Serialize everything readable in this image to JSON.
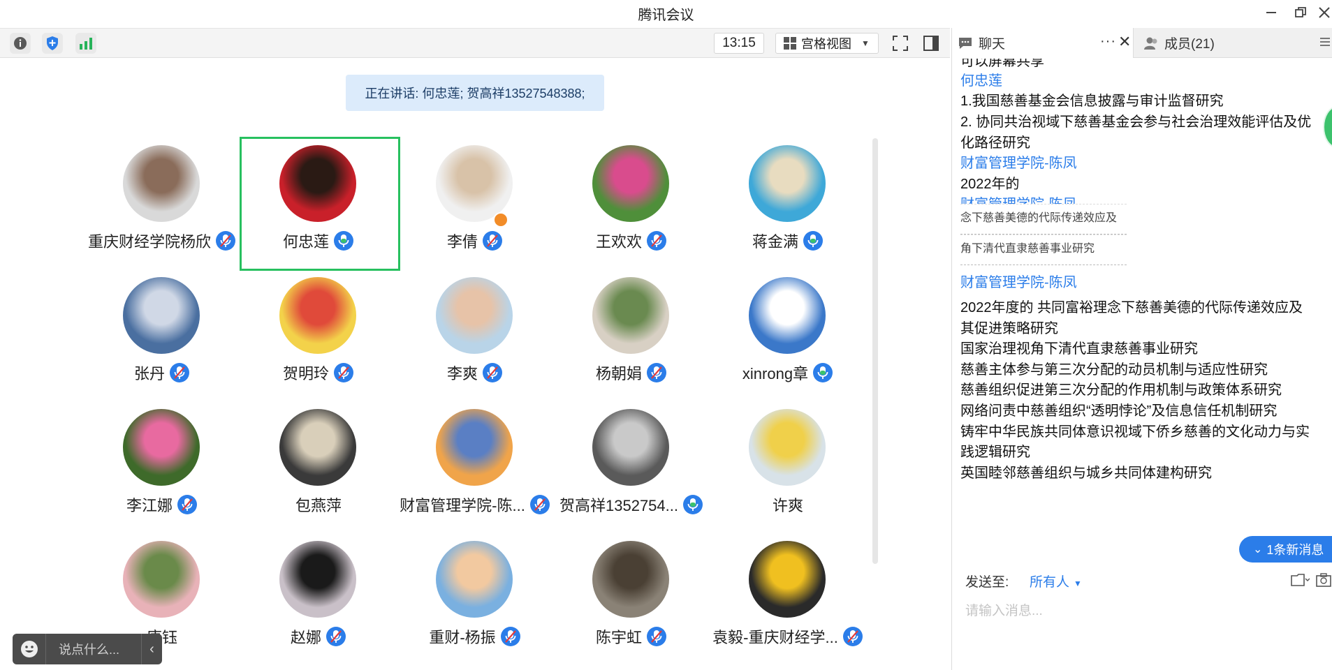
{
  "window": {
    "title": "腾讯会议",
    "minimize_icon": "minimize-icon",
    "restore_icon": "restore-icon",
    "close_icon": "close-icon"
  },
  "toolbar": {
    "time": "13:15",
    "view_label": "宫格视图",
    "accent": "#2b7de9"
  },
  "main": {
    "speaking_text": "正在讲话: 何忠莲; 贺高祥13527548388;",
    "participants": [
      {
        "name": "重庆财经学院杨欣",
        "mic": "muted"
      },
      {
        "name": "何忠莲",
        "mic": "on",
        "active": true
      },
      {
        "name": "李倩",
        "mic": "muted",
        "host": true
      },
      {
        "name": "王欢欢",
        "mic": "muted"
      },
      {
        "name": "蒋金满",
        "mic": "on"
      },
      {
        "name": "张丹",
        "mic": "muted"
      },
      {
        "name": "贺明玲",
        "mic": "muted"
      },
      {
        "name": "李爽",
        "mic": "muted"
      },
      {
        "name": "杨朝娟",
        "mic": "muted"
      },
      {
        "name": "xinrong章",
        "mic": "on"
      },
      {
        "name": "李江娜",
        "mic": "muted"
      },
      {
        "name": "包燕萍",
        "mic": "none"
      },
      {
        "name": "财富管理学院-陈...",
        "mic": "muted"
      },
      {
        "name": "贺高祥1352754...",
        "mic": "on"
      },
      {
        "name": "许爽",
        "mic": "none"
      },
      {
        "name": "唐钰",
        "mic": "none"
      },
      {
        "name": "赵娜",
        "mic": "muted"
      },
      {
        "name": "重财-杨振",
        "mic": "muted"
      },
      {
        "name": "陈宇虹",
        "mic": "muted"
      },
      {
        "name": "袁毅-重庆财经学...",
        "mic": "muted"
      }
    ],
    "chat_placeholder": "说点什么..."
  },
  "panel": {
    "chat_tab": "聊天",
    "members_tab": "成员(21)",
    "messages": [
      {
        "text": "可以屏幕共享",
        "kind": "partial"
      },
      {
        "text": "何忠莲",
        "kind": "sender"
      },
      {
        "text": "1.我国慈善基金会信息披露与审计监督研究",
        "kind": "text"
      },
      {
        "text": "2. 协同共治视域下慈善基金会参与社会治理效能评估及优",
        "kind": "text"
      },
      {
        "text": "化路径研究",
        "kind": "text"
      },
      {
        "text": "财富管理学院-陈凤",
        "kind": "sender"
      },
      {
        "text": "2022年的",
        "kind": "text"
      },
      {
        "text": "财富管理学院-陈凤",
        "kind": "sender"
      },
      {
        "text": "财富管理学院-陈凤",
        "kind": "sender"
      },
      {
        "text": "2022年度的   共同富裕理念下慈善美德的代际传递效应及",
        "kind": "text"
      },
      {
        "text": "其促进策略研究",
        "kind": "text"
      },
      {
        "text": "国家治理视角下清代直隶慈善事业研究",
        "kind": "text"
      },
      {
        "text": "慈善主体参与第三次分配的动员机制与适应性研究",
        "kind": "text"
      },
      {
        "text": "慈善组织促进第三次分配的作用机制与政策体系研究",
        "kind": "text"
      },
      {
        "text": "网络问责中慈善组织“透明悖论”及信息信任机制研究",
        "kind": "text"
      },
      {
        "text": "铸牢中华民族共同体意识视域下侨乡慈善的文化动力与实",
        "kind": "text"
      },
      {
        "text": "践逻辑研究",
        "kind": "text"
      },
      {
        "text": "英国睦邻慈善组织与城乡共同体建构研究",
        "kind": "text"
      }
    ],
    "quote_lines": [
      "念下慈善美德的代际传递效应及",
      "角下清代直隶慈善事业研究"
    ],
    "new_message_badge": "1条新消息",
    "send_to_label": "发送至:",
    "send_to_value": "所有人",
    "input_placeholder": "请输入消息..."
  }
}
